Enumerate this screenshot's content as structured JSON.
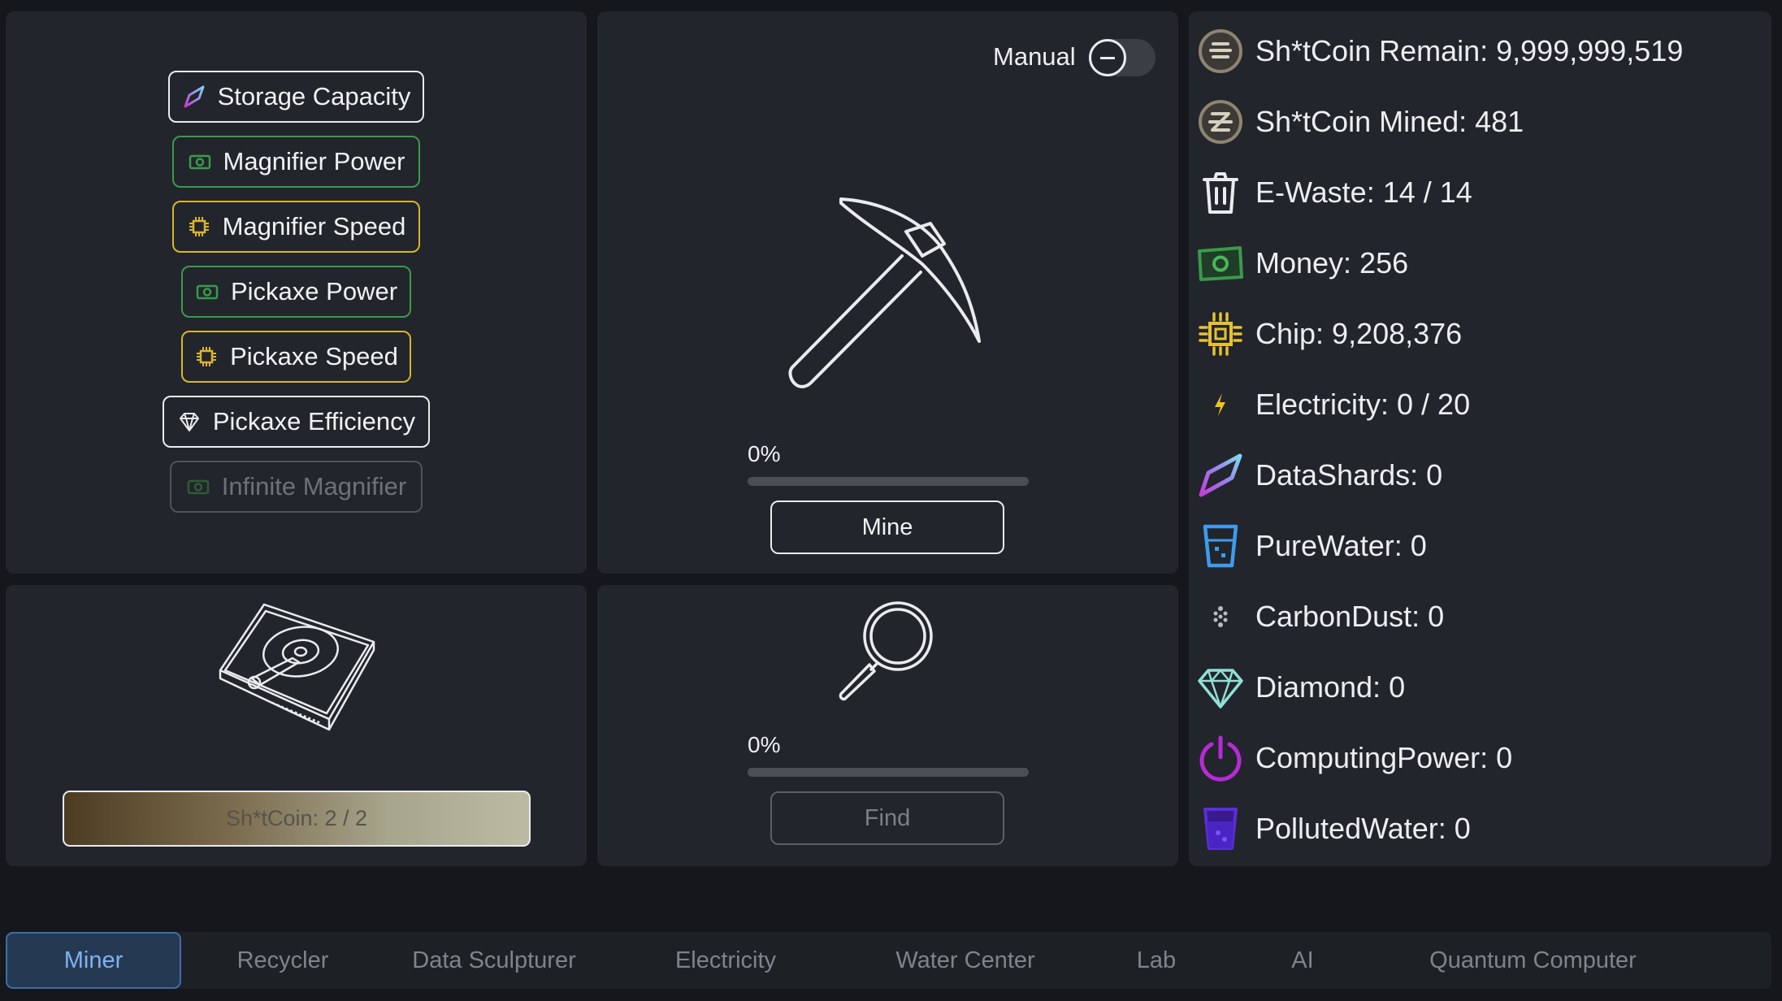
{
  "upgrades": [
    {
      "label": "Storage Capacity",
      "icon": "data-shard-icon",
      "variant": "white"
    },
    {
      "label": "Magnifier Power",
      "icon": "money-icon",
      "variant": "green"
    },
    {
      "label": "Magnifier Speed",
      "icon": "chip-icon",
      "variant": "yellow"
    },
    {
      "label": "Pickaxe Power",
      "icon": "money-icon",
      "variant": "green"
    },
    {
      "label": "Pickaxe Speed",
      "icon": "chip-icon",
      "variant": "yellow"
    },
    {
      "label": "Pickaxe Efficiency",
      "icon": "diamond-icon",
      "variant": "white"
    },
    {
      "label": "Infinite Magnifier",
      "icon": "money-icon",
      "variant": "disabled"
    }
  ],
  "mine": {
    "toggle_label": "Manual",
    "toggle_on": false,
    "progress_text": "0%",
    "progress": 0,
    "button_label": "Mine"
  },
  "find": {
    "progress_text": "0%",
    "progress": 0,
    "button_label": "Find"
  },
  "storage": {
    "text": "Sh*tCoin: 2  / 2",
    "fill_fraction": 1.0
  },
  "stats": [
    {
      "text": "Sh*tCoin Remain: 9,999,999,519",
      "icon": "coin-stack-icon"
    },
    {
      "text": "Sh*tCoin Mined: 481",
      "icon": "coin-mined-icon"
    },
    {
      "text": "E-Waste: 14 / 14",
      "icon": "trash-icon"
    },
    {
      "text": "Money: 256",
      "icon": "money-icon"
    },
    {
      "text": "Chip: 9,208,376",
      "icon": "chip-icon"
    },
    {
      "text": "Electricity: 0 / 20",
      "icon": "lightning-icon"
    },
    {
      "text": "DataShards: 0",
      "icon": "data-shard-icon"
    },
    {
      "text": "PureWater: 0",
      "icon": "pure-water-icon"
    },
    {
      "text": "CarbonDust: 0",
      "icon": "carbon-dust-icon"
    },
    {
      "text": "Diamond: 0",
      "icon": "diamond-icon"
    },
    {
      "text": "ComputingPower: 0",
      "icon": "power-icon"
    },
    {
      "text": "PollutedWater: 0",
      "icon": "polluted-water-icon"
    }
  ],
  "tabs": [
    {
      "label": "Miner",
      "active": true
    },
    {
      "label": "Recycler",
      "active": false
    },
    {
      "label": "Data Sculpturer",
      "active": false
    },
    {
      "label": "Electricity",
      "active": false
    },
    {
      "label": "Water Center",
      "active": false
    },
    {
      "label": "Lab",
      "active": false
    },
    {
      "label": "AI",
      "active": false
    },
    {
      "label": "Quantum Computer",
      "active": false
    }
  ],
  "colors": {
    "background": "#15171c",
    "panel": "#22252b",
    "green": "#3a9a4a",
    "yellow": "#d9b52c",
    "active_tab": "#7fb2f0"
  }
}
